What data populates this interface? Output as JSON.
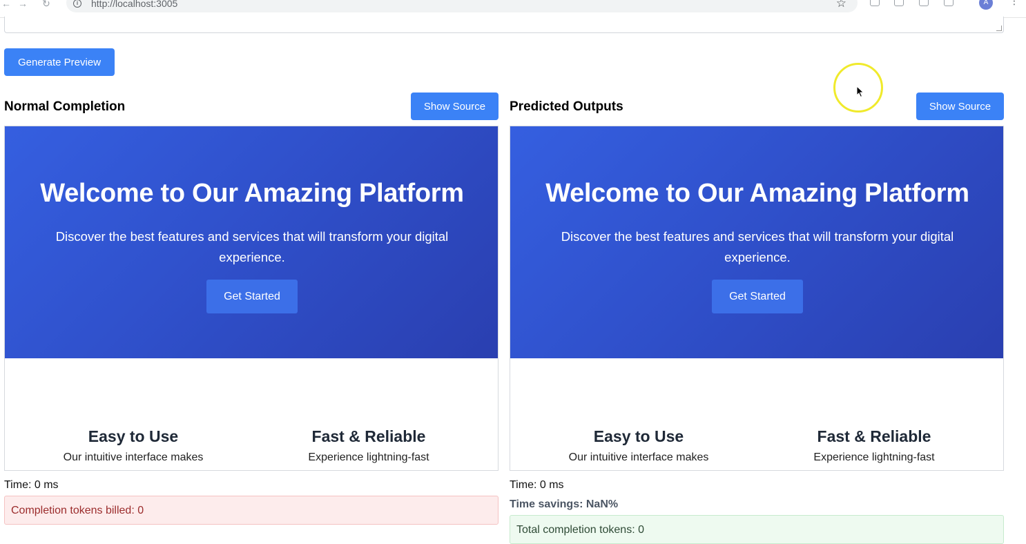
{
  "browser": {
    "url": "http://localhost:3005",
    "avatar_letter": "A"
  },
  "toolbar": {
    "generate_label": "Generate Preview"
  },
  "panels": [
    {
      "title": "Normal Completion",
      "show_source_label": "Show Source",
      "hero_title": "Welcome to Our Amazing Platform",
      "hero_text": "Discover the best features and services that will transform your digital experience.",
      "cta_label": "Get Started",
      "features": [
        {
          "title": "Easy to Use",
          "desc": "Our intuitive interface makes"
        },
        {
          "title": "Fast & Reliable",
          "desc": "Experience lightning-fast"
        }
      ],
      "time": "Time: 0 ms",
      "tokens_billed": "Completion tokens billed: 0"
    },
    {
      "title": "Predicted Outputs",
      "show_source_label": "Show Source",
      "hero_title": "Welcome to Our Amazing Platform",
      "hero_text": "Discover the best features and services that will transform your digital experience.",
      "cta_label": "Get Started",
      "features": [
        {
          "title": "Easy to Use",
          "desc": "Our intuitive interface makes"
        },
        {
          "title": "Fast & Reliable",
          "desc": "Experience lightning-fast"
        }
      ],
      "time": "Time: 0 ms",
      "time_savings": "Time savings: NaN%",
      "total_tokens": "Total completion tokens: 0"
    }
  ],
  "colors": {
    "accent": "#3b82f6",
    "hero_start": "#355fe0",
    "hero_end": "#2a3fb0",
    "error_bg": "#fdecec",
    "success_bg": "#eefaf0"
  }
}
